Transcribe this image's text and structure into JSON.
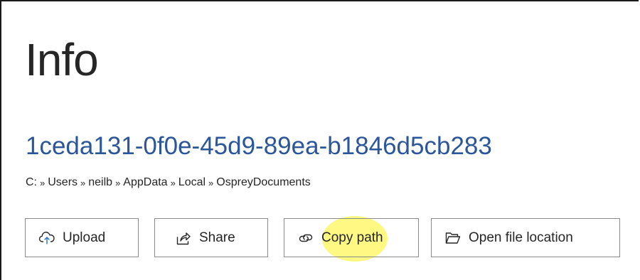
{
  "info": {
    "title": "Info",
    "document_name": "1ceda131-0f0e-45d9-89ea-b1846d5cb283",
    "path": [
      "C:",
      "Users",
      "neilb",
      "AppData",
      "Local",
      "OspreyDocuments"
    ],
    "path_separator": "»"
  },
  "actions": {
    "upload_label": "Upload",
    "share_label": "Share",
    "copy_path_label": "Copy path",
    "open_location_label": "Open file location"
  },
  "icons": {
    "upload": "cloud-upload-icon",
    "share": "share-icon",
    "copy_path": "link-icon",
    "open_location": "folder-open-icon"
  },
  "colors": {
    "document_name": "#2b579a",
    "highlight": "#fff55a",
    "text": "#262626"
  }
}
